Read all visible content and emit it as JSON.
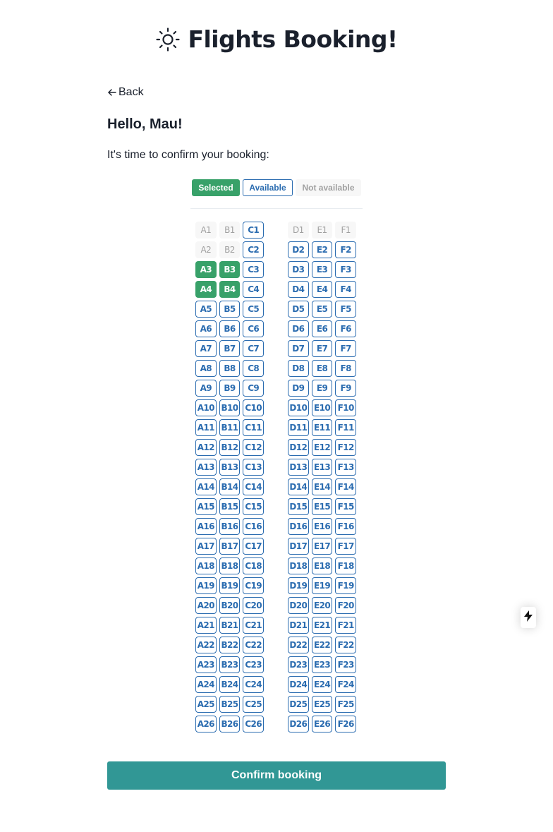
{
  "header": {
    "title": "Flights Booking!",
    "icon": "sun-icon"
  },
  "nav": {
    "back_label": "Back"
  },
  "main": {
    "greeting": "Hello, Mau!",
    "subtitle": "It's time to confirm your booking:"
  },
  "legend": {
    "selected": "Selected",
    "available": "Available",
    "unavailable": "Not available"
  },
  "seat_map": {
    "columns": [
      "A",
      "B",
      "C",
      "D",
      "E",
      "F"
    ],
    "row_count": 26,
    "selected": [
      "A3",
      "B3",
      "A4",
      "B4"
    ],
    "unavailable": [
      "A1",
      "B1",
      "D1",
      "E1",
      "F1",
      "A2",
      "B2"
    ]
  },
  "actions": {
    "confirm_label": "Confirm booking"
  },
  "colors": {
    "selected": "#38a169",
    "available": "#2b6cb0",
    "unavailable_bg": "#f7f7f7",
    "confirm": "#319795"
  },
  "floating": {
    "icon": "lightning-bolt-icon"
  }
}
